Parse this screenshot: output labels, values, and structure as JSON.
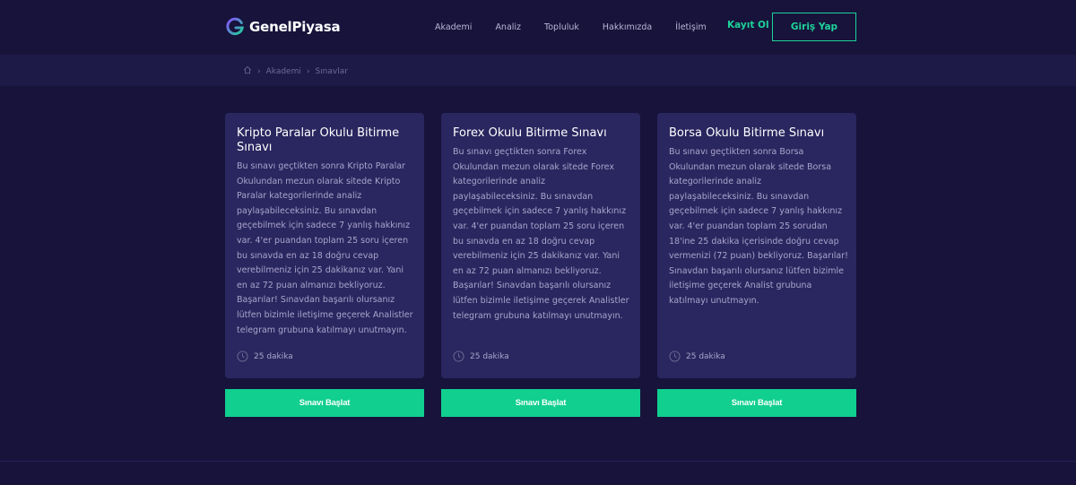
{
  "brand": {
    "name": "GenelPiyasa",
    "accent": "#1ed39a"
  },
  "nav": {
    "items": [
      "Akademi",
      "Analiz",
      "Topluluk",
      "Hakkımızda",
      "İletişim"
    ],
    "register_label": "Kayıt Ol",
    "login_label": "Giriş Yap"
  },
  "breadcrumb": {
    "items": [
      "Akademi",
      "Sınavlar"
    ],
    "home_icon": "home-icon"
  },
  "cards": [
    {
      "title": "Kripto Paralar Okulu Bitirme Sınavı",
      "description": "Bu sınavı geçtikten sonra Kripto Paralar Okulundan mezun olarak sitede Kripto Paralar kategorilerinde analiz paylaşabileceksiniz. Bu sınavdan geçebilmek için sadece 7 yanlış hakkınız var. 4'er puandan toplam 25 soru içeren bu sınavda en az 18 doğru cevap verebilmeniz için 25 dakikanız var. Yani en az 72 puan almanızı bekliyoruz. Başarılar! Sınavdan başarılı olursanız lütfen bizimle iletişime geçerek Analistler telegram grubuna katılmayı unutmayın.",
      "duration": "25 dakika",
      "button_label": "Sınavı Başlat"
    },
    {
      "title": "Forex Okulu Bitirme Sınavı",
      "description": "Bu sınavı geçtikten sonra Forex Okulundan mezun olarak sitede Forex kategorilerinde analiz paylaşabileceksiniz. Bu sınavdan geçebilmek için sadece 7 yanlış hakkınız var. 4'er puandan toplam 25 soru içeren bu sınavda en az 18 doğru cevap verebilmeniz için 25 dakikanız var. Yani en az 72 puan almanızı bekliyoruz. Başarılar! Sınavdan başarılı olursanız lütfen bizimle iletişime geçerek Analistler telegram grubuna katılmayı unutmayın.",
      "duration": "25 dakika",
      "button_label": "Sınavı Başlat"
    },
    {
      "title": "Borsa Okulu Bitirme Sınavı",
      "description": "Bu sınavı geçtikten sonra Borsa Okulundan mezun olarak sitede Borsa kategorilerinde analiz paylaşabileceksiniz. Bu sınavdan geçebilmek için sadece 7 yanlış hakkınız var. 4'er puandan toplam 25 sorudan 18'ine 25 dakika içerisinde doğru cevap vermenizi (72 puan) bekliyoruz. Başarılar! Sınavdan başarılı olursanız lütfen bizimle iletişime geçerek Analist grubuna katılmayı unutmayın.",
      "duration": "25 dakika",
      "button_label": "Sınavı Başlat"
    }
  ],
  "colors": {
    "background": "#17133b",
    "card": "#2a265f",
    "button": "#10cf8f"
  }
}
